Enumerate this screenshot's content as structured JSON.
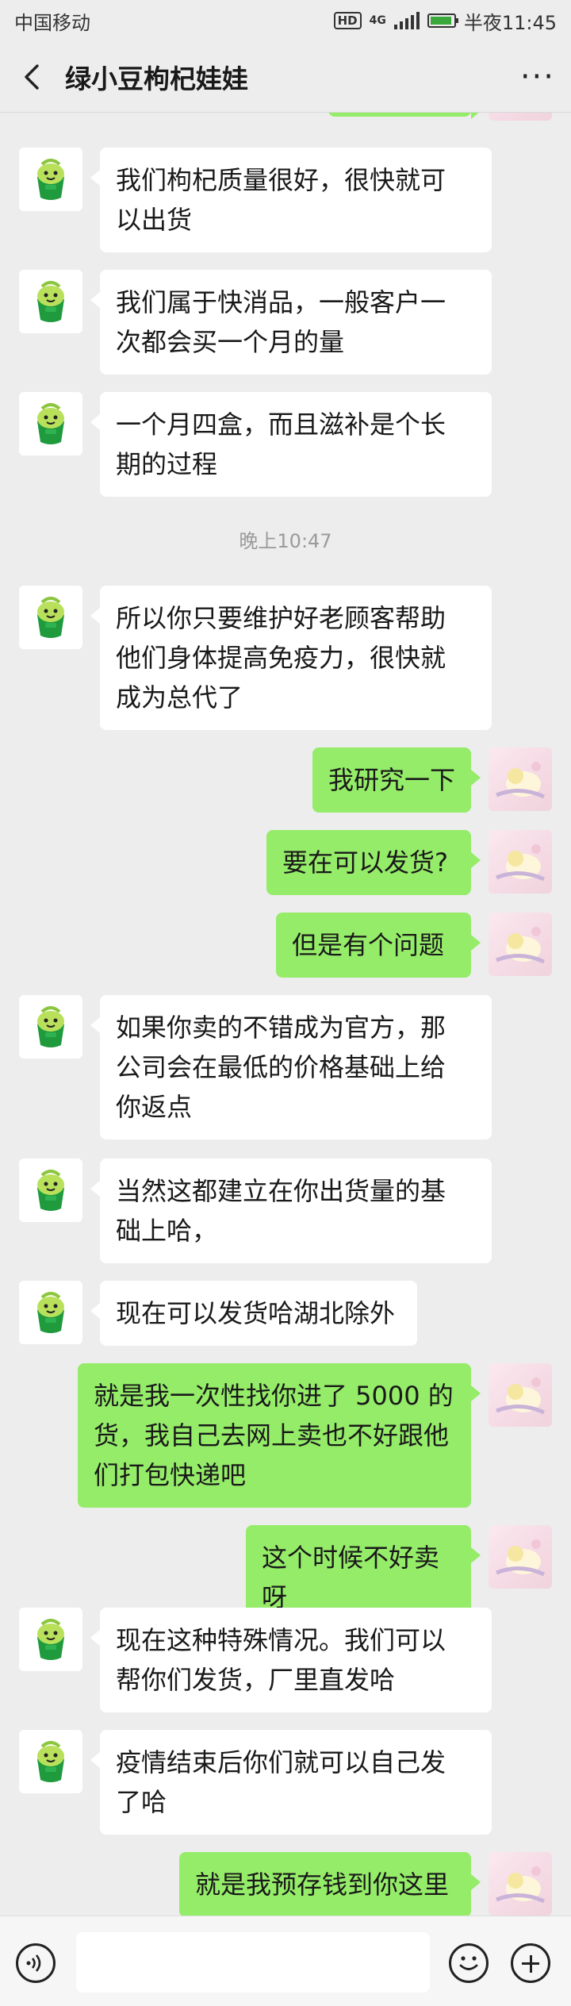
{
  "status_bar": {
    "carrier": "中国移动",
    "network": "HD",
    "network_type": "4G",
    "time": "半夜11:45"
  },
  "header": {
    "title": "绿小豆枸杞娃娃"
  },
  "colors": {
    "sent_bubble": "#95ec69",
    "received_bubble": "#ffffff",
    "background": "#ededed"
  },
  "messages": [
    {
      "side": "left",
      "text": "我们枸杞质量很好，很快就可\n以出货"
    },
    {
      "side": "left",
      "text": "我们属于快消品，一般客户一\n次都会买一个月的量"
    },
    {
      "side": "left",
      "text": "一个月四盒，而且滋补是个长\n期的过程"
    },
    {
      "type": "time",
      "text": "晚上10:47"
    },
    {
      "side": "left",
      "text": "所以你只要维护好老顾客帮助\n他们身体提高免疫力，很快就\n成为总代了"
    },
    {
      "side": "right",
      "text": "我研究一下"
    },
    {
      "side": "right",
      "text": "要在可以发货?"
    },
    {
      "side": "right",
      "text": "但是有个问题"
    },
    {
      "side": "left",
      "text": "如果你卖的不错成为官方，那\n公司会在最低的价格基础上给\n你返点"
    },
    {
      "side": "left",
      "text": "当然这都建立在你出货量的基\n础上哈，"
    },
    {
      "side": "left",
      "text": "现在可以发货哈湖北除外"
    },
    {
      "side": "right",
      "text": "就是我一次性找你进了 5000 的\n货，我自己去网上卖也不好跟他\n们打包快递吧"
    },
    {
      "side": "right",
      "text": "这个时候不好卖呀"
    },
    {
      "side": "left",
      "text": "现在这种特殊情况。我们可以\n帮你们发货，厂里直发哈"
    },
    {
      "side": "left",
      "text": "疫情结束后你们就可以自己发\n了哈"
    },
    {
      "side": "right",
      "text": "就是我预存钱到你这里"
    }
  ],
  "input_bar": {
    "voice_icon": "voice-icon",
    "emoji_icon": "emoji-icon",
    "plus_icon": "plus-icon",
    "text_value": ""
  }
}
